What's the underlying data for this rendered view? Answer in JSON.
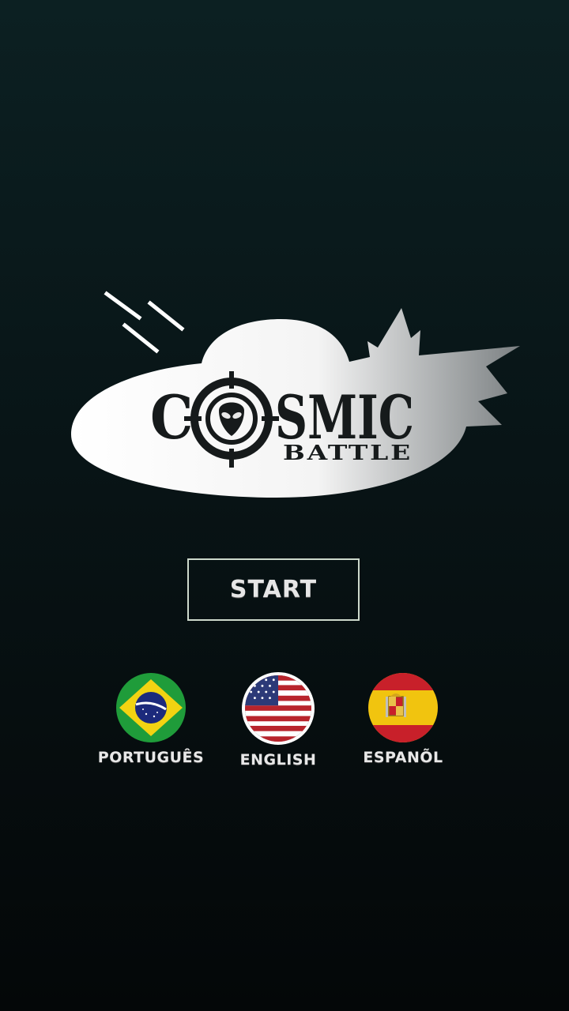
{
  "logo": {
    "title_left": "C",
    "title_right": "SMIC",
    "subtitle": "BATTLE"
  },
  "menu": {
    "start_label": "START"
  },
  "languages": [
    {
      "label": "PORTUGUÊS",
      "flag": "brazil-flag-icon",
      "selected": false
    },
    {
      "label": "ENGLISH",
      "flag": "usa-flag-icon",
      "selected": true
    },
    {
      "label": "ESPANÕL",
      "flag": "spain-flag-icon",
      "selected": false
    }
  ],
  "colors": {
    "background_top": "#0c2022",
    "background_bottom": "#040708",
    "button_border": "#cdd9cc",
    "selected_ring": "#ffffff"
  }
}
